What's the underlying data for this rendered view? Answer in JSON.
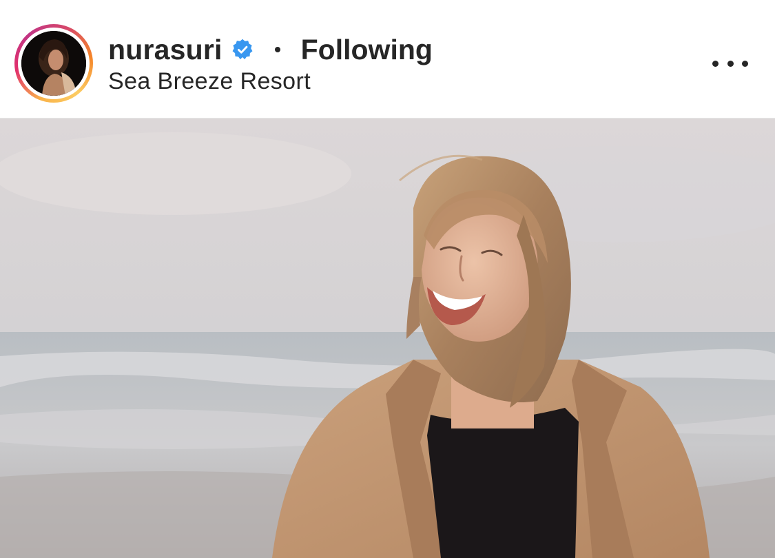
{
  "post": {
    "header": {
      "username": "nurasuri",
      "verified": true,
      "separator": "•",
      "follow_status": "Following",
      "location": "Sea Breeze Resort",
      "more_icon": "more-horizontal-icon",
      "avatar_icon": "profile-avatar"
    },
    "media": {
      "type": "photo",
      "subject": "smiling woman with windswept blonde hair in a camel coat on a beach"
    },
    "colors": {
      "text": "#262626",
      "verified_badge": "#3897f0",
      "story_ring_start": "#f9b34a",
      "story_ring_end": "#c13584"
    }
  }
}
